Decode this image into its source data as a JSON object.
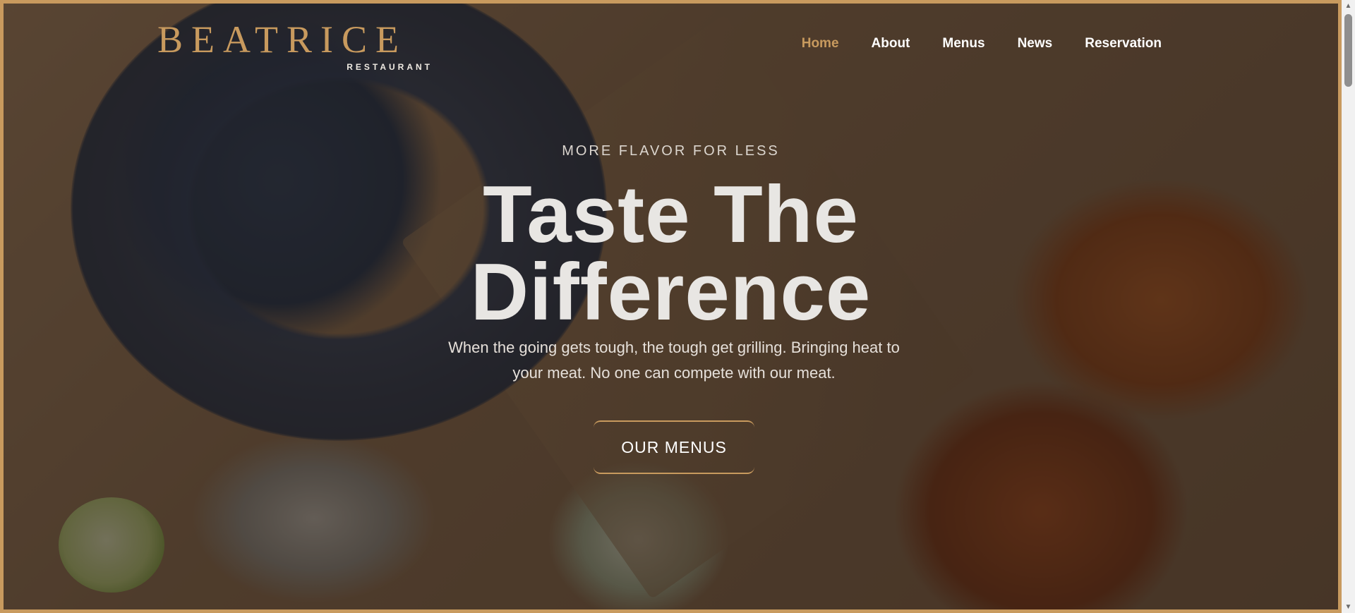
{
  "brand": {
    "name": "BEATRICE",
    "subtitle": "RESTAURANT",
    "accent_color": "#c89a5e"
  },
  "nav": {
    "items": [
      {
        "label": "Home",
        "active": true
      },
      {
        "label": "About",
        "active": false
      },
      {
        "label": "Menus",
        "active": false
      },
      {
        "label": "News",
        "active": false
      },
      {
        "label": "Reservation",
        "active": false
      }
    ]
  },
  "hero": {
    "eyebrow": "MORE FLAVOR FOR LESS",
    "headline_line1": "Taste The",
    "headline_line2": "Difference",
    "subtext": "When the going gets tough, the tough get grilling. Bringing heat to your meat. No one can compete with our meat.",
    "cta_label": "OUR MENUS"
  },
  "scrollbar": {
    "up_icon": "▲",
    "down_icon": "▼"
  }
}
